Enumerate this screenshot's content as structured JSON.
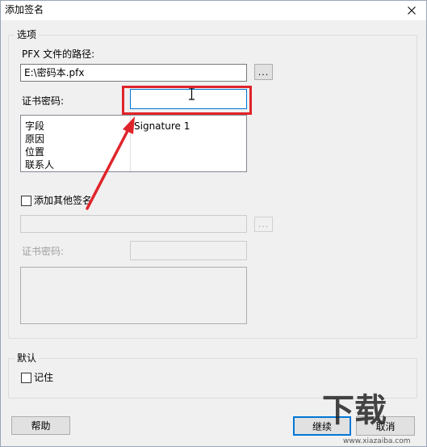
{
  "window": {
    "title": "添加签名",
    "close_symbol": "✕"
  },
  "options": {
    "legend": "选项",
    "pfx_label": "PFX 文件的路径:",
    "pfx_value": "E:\\密码本.pfx",
    "browse_label": "...",
    "password_label": "证书密码:",
    "password_value": "",
    "fields": [
      "字段",
      "原因",
      "位置",
      "联系人"
    ],
    "field_values": [
      "Signature 1",
      "",
      "",
      ""
    ],
    "add_other_label": "添加其他签名",
    "add_other_checked": false,
    "other_path_value": "",
    "other_browse_label": "...",
    "other_password_label": "证书密码:",
    "other_password_value": ""
  },
  "defaults": {
    "legend": "默认",
    "remember_label": "记住",
    "remember_checked": false
  },
  "buttons": {
    "help": "帮助",
    "continue": "继续",
    "cancel": "取消"
  },
  "watermark": {
    "text": "下载",
    "subtext": "www.xiazaiba.com"
  },
  "annotation": {
    "color": "#e0242b"
  }
}
